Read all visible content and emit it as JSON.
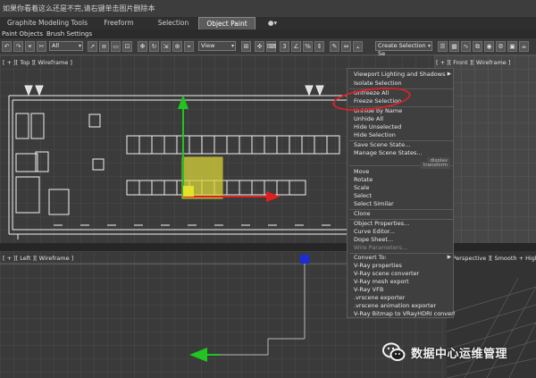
{
  "notice_bar": {
    "text": "如果你看着这么还是不完,请右键单击图片删除本"
  },
  "ribbon": {
    "tabs": [
      {
        "label": "Graphite Modeling Tools",
        "active": false
      },
      {
        "label": "Freeform",
        "active": false
      },
      {
        "label": "Selection",
        "active": false
      },
      {
        "label": "Object Paint",
        "active": true
      },
      {
        "label": "●▾",
        "active": false
      }
    ],
    "subtabs": [
      "Paint Objects",
      "Brush Settings"
    ]
  },
  "toolbar": {
    "filter_select": "All",
    "view_select": "View",
    "selection_set": "Create Selection Se"
  },
  "viewports": {
    "top_label": "[ + ][ Top ][ Wireframe ]",
    "front_label": "[ + ][ Front ][ Wireframe ]",
    "left_label": "[ + ][ Left ][ Wireframe ]",
    "persp_label": "[ Perspective ][ Smooth + Highl"
  },
  "quad_menu": {
    "items": [
      {
        "label": "Viewport Lighting and Shadows",
        "arrow": true
      },
      {
        "label": "Isolate Selection",
        "arrow": false
      },
      {
        "label": "Unfreeze All",
        "arrow": false
      },
      {
        "label": "Freeze Selection",
        "arrow": false
      },
      {
        "label": "Unhide by Name",
        "arrow": false
      },
      {
        "label": "Unhide All",
        "arrow": false
      },
      {
        "label": "Hide Unselected",
        "arrow": false
      },
      {
        "label": "Hide Selection",
        "arrow": false
      },
      {
        "label": "Save Scene State...",
        "arrow": false
      },
      {
        "label": "Manage Scene States...",
        "arrow": false
      },
      {
        "label": "Move",
        "arrow": false
      },
      {
        "label": "Rotate",
        "arrow": false
      },
      {
        "label": "Scale",
        "arrow": false
      },
      {
        "label": "Select",
        "arrow": false
      },
      {
        "label": "Select Similar",
        "arrow": false
      },
      {
        "label": "Clone",
        "arrow": false
      },
      {
        "label": "Object Properties...",
        "arrow": false
      },
      {
        "label": "Curve Editor...",
        "arrow": false
      },
      {
        "label": "Dope Sheet...",
        "arrow": false
      },
      {
        "label": "Wire Parameters...",
        "arrow": false
      },
      {
        "label": "Convert To:",
        "arrow": true
      },
      {
        "label": "V-Ray properties",
        "arrow": false
      },
      {
        "label": "V-Ray scene converter",
        "arrow": false
      },
      {
        "label": "V-Ray mesh export",
        "arrow": false
      },
      {
        "label": "V-Ray VFB",
        "arrow": false
      },
      {
        "label": ".vrscene exporter",
        "arrow": false
      },
      {
        "label": ".vrscene animation exporter",
        "arrow": false
      },
      {
        "label": "V-Ray Bitmap to VRayHDRI converter",
        "arrow": false
      }
    ],
    "section_display": "display",
    "section_transform": "transform"
  },
  "watermark": {
    "text": "数据中心运维管理"
  },
  "colors": {
    "accent_red": "#d8232a",
    "gizmo_green": "#1fc61f",
    "gizmo_red": "#e02020",
    "gizmo_blue": "#1b2cd8",
    "selection_yellow": "#d7d33a"
  }
}
